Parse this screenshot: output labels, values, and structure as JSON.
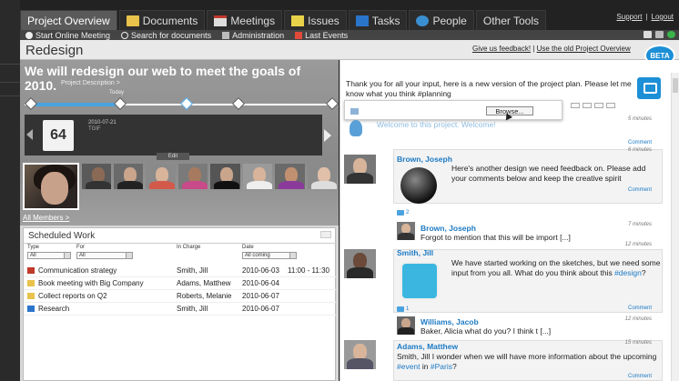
{
  "tabs": [
    {
      "label": "Project Overview",
      "icon": "none",
      "active": true
    },
    {
      "label": "Documents",
      "icon": "documents-icon",
      "active": false
    },
    {
      "label": "Meetings",
      "icon": "meetings-icon",
      "active": false
    },
    {
      "label": "Issues",
      "icon": "issues-icon",
      "active": false
    },
    {
      "label": "Tasks",
      "icon": "tasks-icon",
      "active": false
    },
    {
      "label": "People",
      "icon": "people-icon",
      "active": false
    },
    {
      "label": "Other Tools",
      "icon": "none",
      "active": false
    }
  ],
  "toplinks": {
    "support": "Support",
    "sep": "|",
    "logout": "Logout"
  },
  "subbar": {
    "start_meeting": "Start Online Meeting",
    "search_docs": "Search for documents",
    "administration": "Administration",
    "last_events": "Last Events"
  },
  "header": {
    "title": "Redesign",
    "feedback_link": "Give us feedback!",
    "sep": "|",
    "old_overview_link": "Use the old Project Overview",
    "beta": "BETA"
  },
  "hero": {
    "headline": "We will redesign our web to meet the goals of 2010.",
    "description_link": "Project Description >",
    "today_label": "Today",
    "day_number": "64",
    "event_date": "2010-07-21",
    "event_sub": "TGIF",
    "edit_label": "Edit",
    "all_members": "All Members >"
  },
  "scheduled": {
    "title": "Scheduled Work",
    "filters": [
      {
        "label": "Type",
        "value": "All"
      },
      {
        "label": "For",
        "value": "All"
      },
      {
        "label": "In Charge",
        "value": ""
      },
      {
        "label": "Date",
        "value": "All coming"
      }
    ],
    "rows": [
      {
        "title": "Communication strategy",
        "charge": "Smith, Jill",
        "date": "2010-06-03",
        "time": "11:00 - 11:30",
        "icon": "calendar-icon",
        "icon_color": "#c0392b"
      },
      {
        "title": "Book meeting with Big Company",
        "charge": "Adams, Matthew",
        "date": "2010-06-04",
        "time": "",
        "icon": "folder-icon",
        "icon_color": "#e8c24a"
      },
      {
        "title": "Collect reports on Q2",
        "charge": "Roberts, Melanie",
        "date": "2010-06-07",
        "time": "",
        "icon": "folder-icon",
        "icon_color": "#e8c24a"
      },
      {
        "title": "Research",
        "charge": "Smith, Jill",
        "date": "2010-06-07",
        "time": "",
        "icon": "flag-icon",
        "icon_color": "#2a74c9"
      }
    ]
  },
  "composer": {
    "text": "Thank you for all your input, here is a new version of the project plan. Please let me know what you think #planning",
    "browse_label": "Browse..."
  },
  "feed": {
    "first_ago": "5 minutes",
    "first_text": "Welcome to this project. Welcome!",
    "first_comment": "Comment",
    "post1": {
      "name": "Brown, Joseph",
      "ago": "6 minutes",
      "text": "Here's another design we need feedback on. Please add your comments below and keep the creative spirit",
      "comment": "Comment",
      "count": "2"
    },
    "reply1": {
      "name": "Brown, Joseph",
      "ago": "7 minutes",
      "text": "Forgot to mention that this will be import [...]"
    },
    "post2": {
      "name": "Smith, Jill",
      "ago": "12 minutes",
      "text_a": "We have started working on the sketches, but we need some input from you all. What do you think about this ",
      "tag": "#design",
      "text_b": "?",
      "comment": "Comment",
      "count": "1"
    },
    "reply2": {
      "name": "Williams, Jacob",
      "ago": "12 minutes",
      "text": "Baker, Alicia what do you? I think t [...]"
    },
    "post3": {
      "name": "Adams, Matthew",
      "ago": "15 minutes",
      "text_a": "Smith, Jill I wonder when we will have more information about the upcoming ",
      "tag1": "#event",
      "text_b": " in ",
      "tag2": "#Paris",
      "text_c": "?",
      "comment": "Comment"
    }
  },
  "colors": {
    "accent": "#1c8fd6",
    "link": "#1c7ac4"
  }
}
